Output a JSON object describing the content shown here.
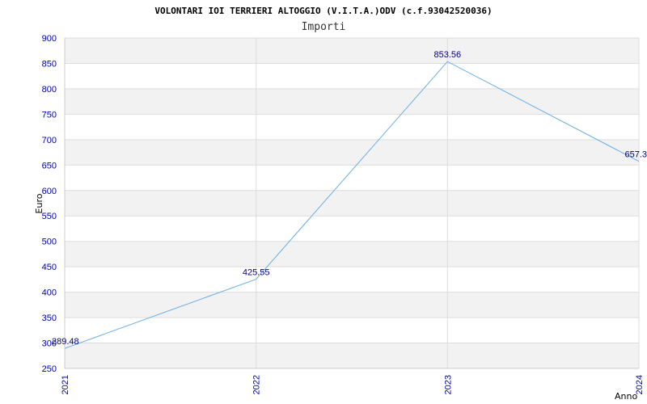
{
  "chart_data": {
    "type": "line",
    "title": "VOLONTARI IOI TERRIERI ALTOGGIO (V.I.T.A.)ODV (c.f.93042520036)",
    "subtitle": "Importi",
    "xlabel": "Anno",
    "ylabel": "Euro",
    "categories": [
      "2021",
      "2022",
      "2023",
      "2024"
    ],
    "values": [
      289.48,
      425.55,
      853.56,
      657.3
    ],
    "value_labels": [
      "289.48",
      "425.55",
      "853.56",
      "657.3"
    ],
    "ylim": [
      250,
      900
    ],
    "yticks": [
      "250",
      "300",
      "350",
      "400",
      "450",
      "500",
      "550",
      "600",
      "650",
      "700",
      "750",
      "800",
      "850",
      "900"
    ],
    "grid": true,
    "colors": {
      "line": "#6aaee8",
      "band": "#f2f2f2",
      "grid": "#dddddd",
      "tick_text": "#0000aa",
      "data_label": "#000080"
    }
  }
}
